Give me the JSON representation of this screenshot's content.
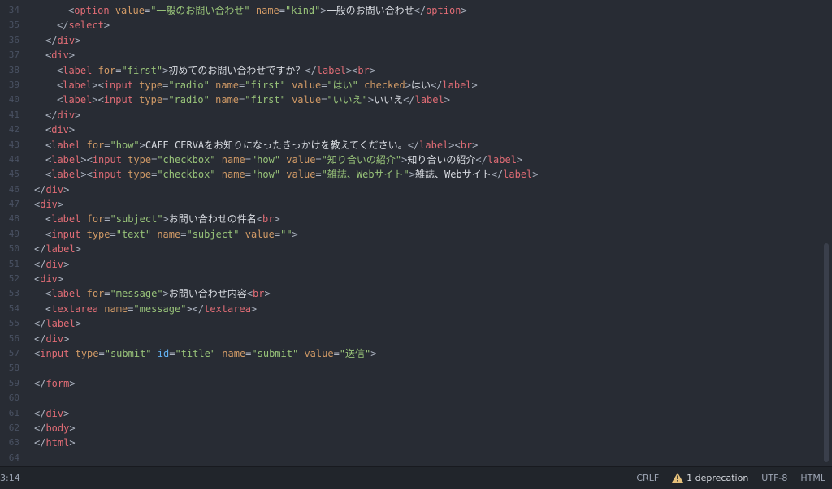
{
  "editor": {
    "lines": [
      {
        "n": "34",
        "indent": 3,
        "tokens": [
          [
            "p",
            "<"
          ],
          [
            "tag",
            "option"
          ],
          [
            "p",
            " "
          ],
          [
            "attr",
            "value"
          ],
          [
            "p",
            "="
          ],
          [
            "str",
            "\"一般のお問い合わせ\""
          ],
          [
            "p",
            " "
          ],
          [
            "attr",
            "name"
          ],
          [
            "p",
            "="
          ],
          [
            "str",
            "\"kind\""
          ],
          [
            "p",
            ">"
          ],
          [
            "txt",
            "一般のお問い合わせ"
          ],
          [
            "p",
            "</"
          ],
          [
            "tag",
            "option"
          ],
          [
            "p",
            ">"
          ]
        ]
      },
      {
        "n": "35",
        "indent": 2,
        "tokens": [
          [
            "p",
            "</"
          ],
          [
            "tag",
            "select"
          ],
          [
            "p",
            ">"
          ]
        ]
      },
      {
        "n": "36",
        "indent": 1,
        "tokens": [
          [
            "p",
            "</"
          ],
          [
            "tag",
            "div"
          ],
          [
            "p",
            ">"
          ]
        ]
      },
      {
        "n": "37",
        "indent": 1,
        "tokens": [
          [
            "p",
            "<"
          ],
          [
            "tag",
            "div"
          ],
          [
            "p",
            ">"
          ]
        ]
      },
      {
        "n": "38",
        "indent": 2,
        "tokens": [
          [
            "p",
            "<"
          ],
          [
            "tag",
            "label"
          ],
          [
            "p",
            " "
          ],
          [
            "attr",
            "for"
          ],
          [
            "p",
            "="
          ],
          [
            "str",
            "\"first\""
          ],
          [
            "p",
            ">"
          ],
          [
            "txt",
            "初めてのお問い合わせですか？"
          ],
          [
            "p",
            "</"
          ],
          [
            "tag",
            "label"
          ],
          [
            "p",
            "><"
          ],
          [
            "tag",
            "br"
          ],
          [
            "p",
            ">"
          ]
        ]
      },
      {
        "n": "39",
        "indent": 2,
        "tokens": [
          [
            "p",
            "<"
          ],
          [
            "tag",
            "label"
          ],
          [
            "p",
            "><"
          ],
          [
            "tag",
            "input"
          ],
          [
            "p",
            " "
          ],
          [
            "attr",
            "type"
          ],
          [
            "p",
            "="
          ],
          [
            "str",
            "\"radio\""
          ],
          [
            "p",
            " "
          ],
          [
            "attr",
            "name"
          ],
          [
            "p",
            "="
          ],
          [
            "str",
            "\"first\""
          ],
          [
            "p",
            " "
          ],
          [
            "attr",
            "value"
          ],
          [
            "p",
            "="
          ],
          [
            "str",
            "\"はい\""
          ],
          [
            "p",
            " "
          ],
          [
            "attr",
            "checked"
          ],
          [
            "p",
            ">"
          ],
          [
            "txt",
            "はい"
          ],
          [
            "p",
            "</"
          ],
          [
            "tag",
            "label"
          ],
          [
            "p",
            ">"
          ]
        ]
      },
      {
        "n": "40",
        "indent": 2,
        "tokens": [
          [
            "p",
            "<"
          ],
          [
            "tag",
            "label"
          ],
          [
            "p",
            "><"
          ],
          [
            "tag",
            "input"
          ],
          [
            "p",
            " "
          ],
          [
            "attr",
            "type"
          ],
          [
            "p",
            "="
          ],
          [
            "str",
            "\"radio\""
          ],
          [
            "p",
            " "
          ],
          [
            "attr",
            "name"
          ],
          [
            "p",
            "="
          ],
          [
            "str",
            "\"first\""
          ],
          [
            "p",
            " "
          ],
          [
            "attr",
            "value"
          ],
          [
            "p",
            "="
          ],
          [
            "str",
            "\"いいえ\""
          ],
          [
            "p",
            ">"
          ],
          [
            "txt",
            "いいえ"
          ],
          [
            "p",
            "</"
          ],
          [
            "tag",
            "label"
          ],
          [
            "p",
            ">"
          ]
        ]
      },
      {
        "n": "41",
        "indent": 1,
        "tokens": [
          [
            "p",
            "</"
          ],
          [
            "tag",
            "div"
          ],
          [
            "p",
            ">"
          ]
        ]
      },
      {
        "n": "42",
        "indent": 1,
        "tokens": [
          [
            "p",
            "<"
          ],
          [
            "tag",
            "div"
          ],
          [
            "p",
            ">"
          ]
        ]
      },
      {
        "n": "43",
        "indent": 1,
        "tokens": [
          [
            "p",
            "<"
          ],
          [
            "tag",
            "label"
          ],
          [
            "p",
            " "
          ],
          [
            "attr",
            "for"
          ],
          [
            "p",
            "="
          ],
          [
            "str",
            "\"how\""
          ],
          [
            "p",
            ">"
          ],
          [
            "txt",
            "CAFE CERVAをお知りになったきっかけを教えてください。"
          ],
          [
            "p",
            "</"
          ],
          [
            "tag",
            "label"
          ],
          [
            "p",
            "><"
          ],
          [
            "tag",
            "br"
          ],
          [
            "p",
            ">"
          ]
        ]
      },
      {
        "n": "44",
        "indent": 1,
        "tokens": [
          [
            "p",
            "<"
          ],
          [
            "tag",
            "label"
          ],
          [
            "p",
            "><"
          ],
          [
            "tag",
            "input"
          ],
          [
            "p",
            " "
          ],
          [
            "attr",
            "type"
          ],
          [
            "p",
            "="
          ],
          [
            "str",
            "\"checkbox\""
          ],
          [
            "p",
            " "
          ],
          [
            "attr",
            "name"
          ],
          [
            "p",
            "="
          ],
          [
            "str",
            "\"how\""
          ],
          [
            "p",
            " "
          ],
          [
            "attr",
            "value"
          ],
          [
            "p",
            "="
          ],
          [
            "str",
            "\"知り合いの紹介\""
          ],
          [
            "p",
            ">"
          ],
          [
            "txt",
            "知り合いの紹介"
          ],
          [
            "p",
            "</"
          ],
          [
            "tag",
            "label"
          ],
          [
            "p",
            ">"
          ]
        ]
      },
      {
        "n": "45",
        "indent": 1,
        "tokens": [
          [
            "p",
            "<"
          ],
          [
            "tag",
            "label"
          ],
          [
            "p",
            "><"
          ],
          [
            "tag",
            "input"
          ],
          [
            "p",
            " "
          ],
          [
            "attr",
            "type"
          ],
          [
            "p",
            "="
          ],
          [
            "str",
            "\"checkbox\""
          ],
          [
            "p",
            " "
          ],
          [
            "attr",
            "name"
          ],
          [
            "p",
            "="
          ],
          [
            "str",
            "\"how\""
          ],
          [
            "p",
            " "
          ],
          [
            "attr",
            "value"
          ],
          [
            "p",
            "="
          ],
          [
            "str",
            "\"雑誌、Webサイト\""
          ],
          [
            "p",
            ">"
          ],
          [
            "txt",
            "雑誌、Webサイト"
          ],
          [
            "p",
            "</"
          ],
          [
            "tag",
            "label"
          ],
          [
            "p",
            ">"
          ]
        ]
      },
      {
        "n": "46",
        "indent": 0,
        "tokens": [
          [
            "p",
            "</"
          ],
          [
            "tag",
            "div"
          ],
          [
            "p",
            ">"
          ]
        ]
      },
      {
        "n": "47",
        "indent": 0,
        "tokens": [
          [
            "p",
            "<"
          ],
          [
            "tag",
            "div"
          ],
          [
            "p",
            ">"
          ]
        ]
      },
      {
        "n": "48",
        "indent": 1,
        "tokens": [
          [
            "p",
            "<"
          ],
          [
            "tag",
            "label"
          ],
          [
            "p",
            " "
          ],
          [
            "attr",
            "for"
          ],
          [
            "p",
            "="
          ],
          [
            "str",
            "\"subject\""
          ],
          [
            "p",
            ">"
          ],
          [
            "txt",
            "お問い合わせの件名"
          ],
          [
            "p",
            "<"
          ],
          [
            "tag",
            "br"
          ],
          [
            "p",
            ">"
          ]
        ]
      },
      {
        "n": "49",
        "indent": 1,
        "tokens": [
          [
            "p",
            "<"
          ],
          [
            "tag",
            "input"
          ],
          [
            "p",
            " "
          ],
          [
            "attr",
            "type"
          ],
          [
            "p",
            "="
          ],
          [
            "str",
            "\"text\""
          ],
          [
            "p",
            " "
          ],
          [
            "attr",
            "name"
          ],
          [
            "p",
            "="
          ],
          [
            "str",
            "\"subject\""
          ],
          [
            "p",
            " "
          ],
          [
            "attr",
            "value"
          ],
          [
            "p",
            "="
          ],
          [
            "str",
            "\"\""
          ],
          [
            "p",
            ">"
          ]
        ]
      },
      {
        "n": "50",
        "indent": 0,
        "tokens": [
          [
            "p",
            "</"
          ],
          [
            "tag",
            "label"
          ],
          [
            "p",
            ">"
          ]
        ]
      },
      {
        "n": "51",
        "indent": 0,
        "tokens": [
          [
            "p",
            "</"
          ],
          [
            "tag",
            "div"
          ],
          [
            "p",
            ">"
          ]
        ]
      },
      {
        "n": "52",
        "indent": 0,
        "tokens": [
          [
            "p",
            "<"
          ],
          [
            "tag",
            "div"
          ],
          [
            "p",
            ">"
          ]
        ]
      },
      {
        "n": "53",
        "indent": 1,
        "tokens": [
          [
            "p",
            "<"
          ],
          [
            "tag",
            "label"
          ],
          [
            "p",
            " "
          ],
          [
            "attr",
            "for"
          ],
          [
            "p",
            "="
          ],
          [
            "str",
            "\"message\""
          ],
          [
            "p",
            ">"
          ],
          [
            "txt",
            "お問い合わせ内容"
          ],
          [
            "p",
            "<"
          ],
          [
            "tag",
            "br"
          ],
          [
            "p",
            ">"
          ]
        ]
      },
      {
        "n": "54",
        "indent": 1,
        "tokens": [
          [
            "p",
            "<"
          ],
          [
            "tag",
            "textarea"
          ],
          [
            "p",
            " "
          ],
          [
            "attr",
            "name"
          ],
          [
            "p",
            "="
          ],
          [
            "str",
            "\"message\""
          ],
          [
            "p",
            "></"
          ],
          [
            "tag",
            "textarea"
          ],
          [
            "p",
            ">"
          ]
        ]
      },
      {
        "n": "55",
        "indent": 0,
        "tokens": [
          [
            "p",
            "</"
          ],
          [
            "tag",
            "label"
          ],
          [
            "p",
            ">"
          ]
        ]
      },
      {
        "n": "56",
        "indent": 0,
        "tokens": [
          [
            "p",
            "</"
          ],
          [
            "tag",
            "div"
          ],
          [
            "p",
            ">"
          ]
        ]
      },
      {
        "n": "57",
        "indent": 0,
        "tokens": [
          [
            "p",
            "<"
          ],
          [
            "tag",
            "input"
          ],
          [
            "p",
            " "
          ],
          [
            "attr",
            "type"
          ],
          [
            "p",
            "="
          ],
          [
            "str",
            "\"submit\""
          ],
          [
            "p",
            " "
          ],
          [
            "id",
            "id"
          ],
          [
            "p",
            "="
          ],
          [
            "str",
            "\"title\""
          ],
          [
            "p",
            " "
          ],
          [
            "attr",
            "name"
          ],
          [
            "p",
            "="
          ],
          [
            "str",
            "\"submit\""
          ],
          [
            "p",
            " "
          ],
          [
            "attr",
            "value"
          ],
          [
            "p",
            "="
          ],
          [
            "str",
            "\"送信\""
          ],
          [
            "p",
            ">"
          ]
        ]
      },
      {
        "n": "58",
        "indent": 0,
        "tokens": []
      },
      {
        "n": "59",
        "indent": 0,
        "tokens": [
          [
            "p",
            "</"
          ],
          [
            "tag",
            "form"
          ],
          [
            "p",
            ">"
          ]
        ]
      },
      {
        "n": "60",
        "indent": 0,
        "tokens": []
      },
      {
        "n": "61",
        "indent": 0,
        "tokens": [
          [
            "p",
            "</"
          ],
          [
            "tag",
            "div"
          ],
          [
            "p",
            ">"
          ]
        ]
      },
      {
        "n": "62",
        "indent": 0,
        "tokens": [
          [
            "p",
            "</"
          ],
          [
            "tag",
            "body"
          ],
          [
            "p",
            ">"
          ]
        ]
      },
      {
        "n": "63",
        "indent": 0,
        "tokens": [
          [
            "p",
            "</"
          ],
          [
            "tag",
            "html"
          ],
          [
            "p",
            ">"
          ]
        ]
      },
      {
        "n": "64",
        "indent": 0,
        "tokens": []
      }
    ]
  },
  "statusbar": {
    "cursor_position": "3:14",
    "line_ending": "CRLF",
    "deprecation_icon": "warning-icon",
    "deprecation": "1 deprecation",
    "encoding": "UTF-8",
    "grammar": "HTML"
  },
  "colors": {
    "background": "#282c34",
    "tag": "#e06c75",
    "attribute": "#d19a66",
    "string": "#98c379",
    "id_attribute": "#61afef",
    "warning": "#e5c07b"
  }
}
